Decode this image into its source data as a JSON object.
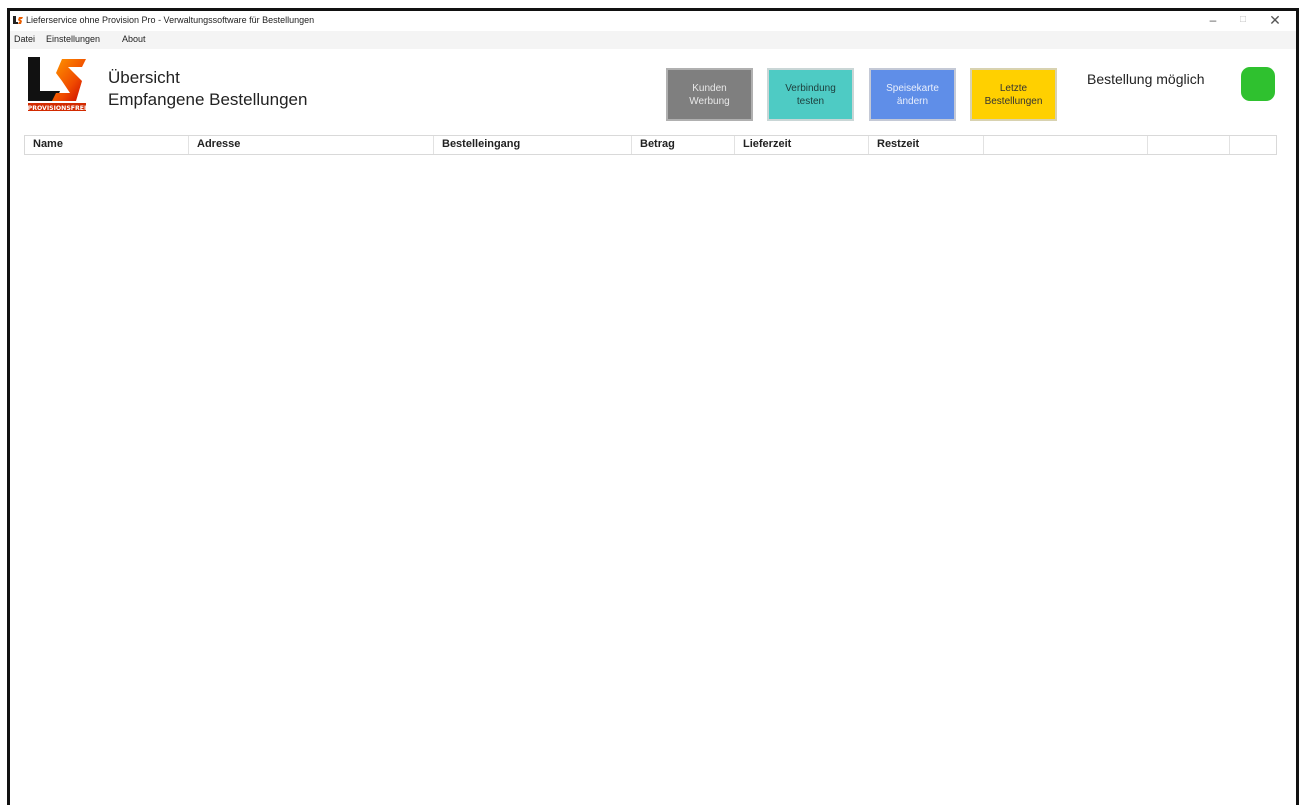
{
  "window": {
    "title": "Lieferservice ohne Provision Pro - Verwaltungssoftware für Bestellungen",
    "controls": {
      "minimize": "–",
      "maximize": "□",
      "close": "✕"
    }
  },
  "menu": {
    "items": [
      "Datei",
      "Einstellungen",
      "About"
    ]
  },
  "header": {
    "logo_text": "PROVISIONSFREI",
    "title": "Übersicht",
    "subtitle": "Empfangene Bestellungen"
  },
  "buttons": {
    "werbung": {
      "line1": "Kunden",
      "line2": "Werbung",
      "color": "#7f7f7f"
    },
    "verbindung": {
      "line1": "Verbindung",
      "line2": "testen",
      "color": "#4ecbc4"
    },
    "speisekarte": {
      "line1": "Speisekarte",
      "line2": "ändern",
      "color": "#5f8ee8"
    },
    "letzte": {
      "line1": "Letzte",
      "line2": "Bestellungen",
      "color": "#ffd000"
    }
  },
  "status": {
    "label": "Bestellung möglich",
    "indicator_color": "#2fc12f"
  },
  "table": {
    "columns": [
      "Name",
      "Adresse",
      "Bestelleingang",
      "Betrag",
      "Lieferzeit",
      "Restzeit",
      "",
      "",
      ""
    ],
    "rows": []
  }
}
